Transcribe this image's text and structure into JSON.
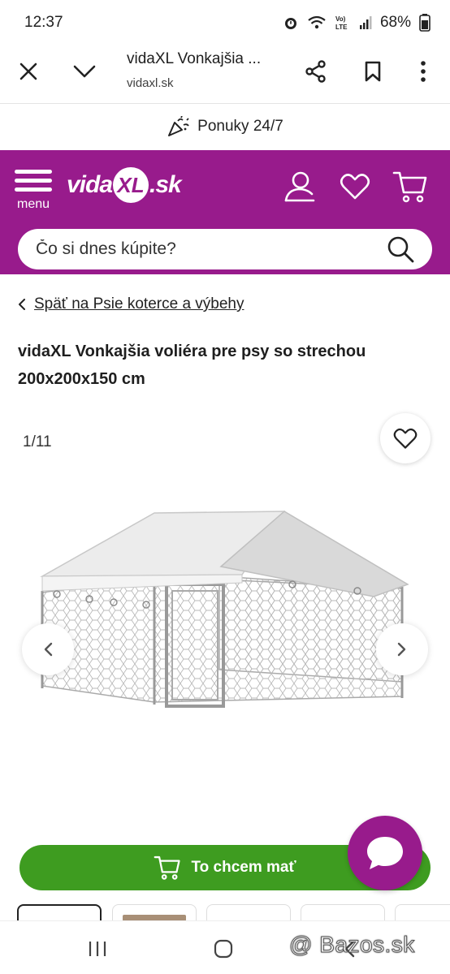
{
  "status_bar": {
    "time": "12:37",
    "battery": "68%"
  },
  "browser": {
    "tab_title": "vidaXL Vonkajšia ...",
    "url": "vidaxl.sk"
  },
  "promo": {
    "label": "Ponuky 24/7"
  },
  "header": {
    "menu_label": "menu",
    "logo_left": "vida",
    "logo_mark": "XL",
    "logo_right": ".sk",
    "brand_color": "#981b8c",
    "search_placeholder": "Čo si dnes kúpite?"
  },
  "breadcrumb": {
    "label": "Späť na Psie koterce a výbehy"
  },
  "product": {
    "title": "vidaXL Vonkajšia voliéra pre psy so strechou 200x200x150 cm",
    "gallery_counter": "1/11"
  },
  "cta": {
    "label": "To chcem mať",
    "color": "#3e9c20"
  },
  "watermark": "@ Bazos.sk",
  "icons": [
    "close-icon",
    "chevron-down-icon",
    "share-icon",
    "bookmark-icon",
    "more-icon",
    "party-icon",
    "user-icon",
    "heart-icon",
    "cart-icon",
    "search-icon",
    "chevron-left-icon",
    "chevron-right-icon",
    "chat-icon",
    "recent-apps-icon",
    "home-icon",
    "back-icon"
  ]
}
